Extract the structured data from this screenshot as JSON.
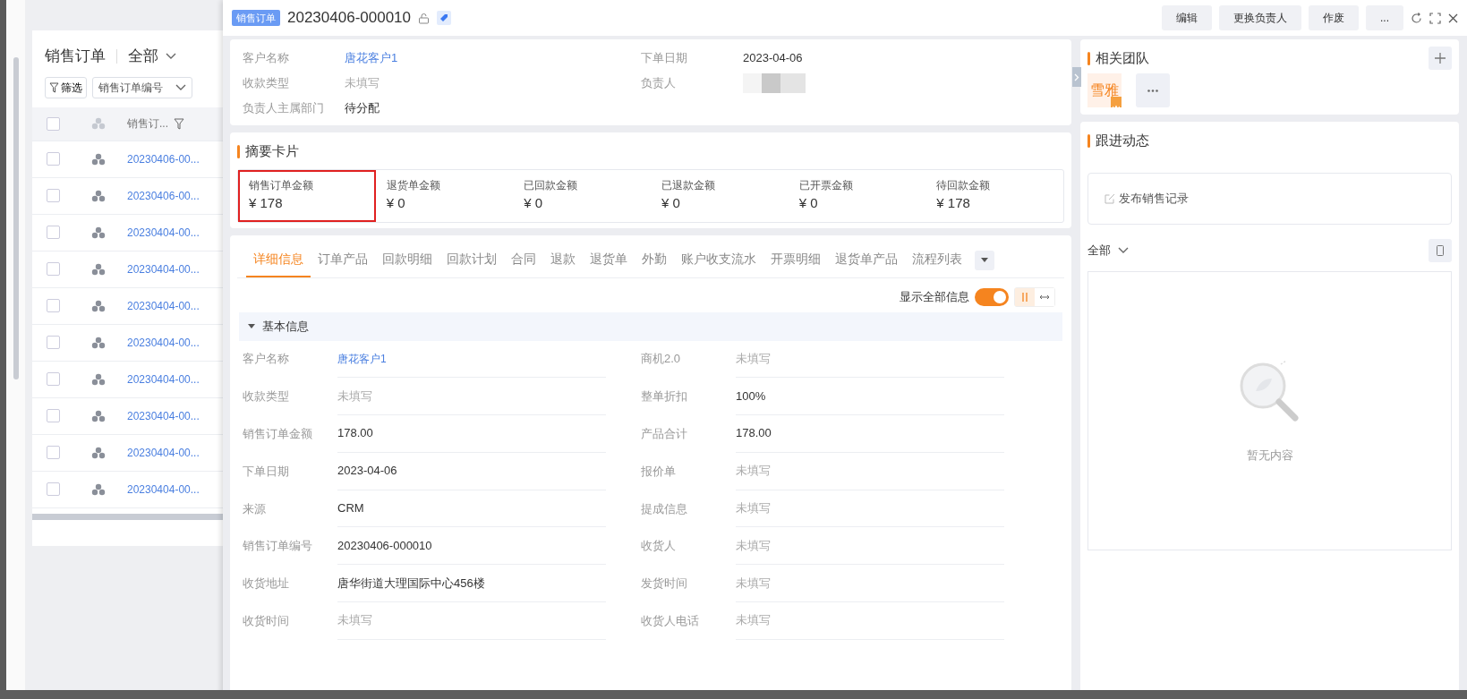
{
  "list_panel": {
    "select_all": {
      "checked": false
    },
    "title": "销售订单",
    "view": "全部",
    "filter_button": "筛选",
    "search_field": "销售订单编号",
    "column": "销售订...",
    "rows": [
      {
        "order_no": "20230406-00...",
        "checked": false
      },
      {
        "order_no": "20230406-00...",
        "checked": false
      },
      {
        "order_no": "20230404-00...",
        "checked": false
      },
      {
        "order_no": "20230404-00...",
        "checked": false
      },
      {
        "order_no": "20230404-00...",
        "checked": false
      },
      {
        "order_no": "20230404-00...",
        "checked": false
      },
      {
        "order_no": "20230404-00...",
        "checked": false
      },
      {
        "order_no": "20230404-00...",
        "checked": false
      },
      {
        "order_no": "20230404-00...",
        "checked": false
      },
      {
        "order_no": "20230404-00...",
        "checked": false
      }
    ]
  },
  "header": {
    "tag": "销售订单",
    "title": "20230406-000010",
    "buttons": [
      "编辑",
      "更换负责人",
      "作废",
      "..."
    ]
  },
  "overview": {
    "fields": [
      {
        "label": "客户名称",
        "value": "唐花客户1",
        "kind": "link"
      },
      {
        "label": "下单日期",
        "value": "2023-04-06",
        "kind": "text"
      },
      {
        "label": "收款类型",
        "value": "未填写",
        "kind": "empty"
      },
      {
        "label": "负责人",
        "kind": "blurred"
      },
      {
        "label": "负责人主属部门",
        "value": "待分配",
        "kind": "text"
      }
    ]
  },
  "summary": {
    "title": "摘要卡片",
    "metrics": [
      {
        "label": "销售订单金额",
        "value": "¥ 178",
        "highlighted": true
      },
      {
        "label": "退货单金额",
        "value": "¥ 0",
        "highlighted": false
      },
      {
        "label": "已回款金额",
        "value": "¥ 0",
        "highlighted": false
      },
      {
        "label": "已退款金额",
        "value": "¥ 0",
        "highlighted": false
      },
      {
        "label": "已开票金额",
        "value": "¥ 0",
        "highlighted": false
      },
      {
        "label": "待回款金额",
        "value": "¥ 178",
        "highlighted": false
      }
    ]
  },
  "tabs": [
    {
      "label": "详细信息",
      "selected": true
    },
    {
      "label": "订单产品",
      "selected": false
    },
    {
      "label": "回款明细",
      "selected": false
    },
    {
      "label": "回款计划",
      "selected": false
    },
    {
      "label": "合同",
      "selected": false
    },
    {
      "label": "退款",
      "selected": false
    },
    {
      "label": "退货单",
      "selected": false
    },
    {
      "label": "外勤",
      "selected": false
    },
    {
      "label": "账户收支流水",
      "selected": false
    },
    {
      "label": "开票明细",
      "selected": false
    },
    {
      "label": "退货单产品",
      "selected": false
    },
    {
      "label": "流程列表",
      "selected": false
    }
  ],
  "show_all": {
    "label": "显示全部信息",
    "on": true
  },
  "section": {
    "title": "基本信息",
    "expanded": true,
    "fields": [
      {
        "label": "客户名称",
        "value": "唐花客户1",
        "kind": "link"
      },
      {
        "label": "商机2.0",
        "value": "未填写",
        "kind": "empty"
      },
      {
        "label": "收款类型",
        "value": "未填写",
        "kind": "empty"
      },
      {
        "label": "整单折扣",
        "value": "100%",
        "kind": "text"
      },
      {
        "label": "销售订单金额",
        "value": "178.00",
        "kind": "text"
      },
      {
        "label": "产品合计",
        "value": "178.00",
        "kind": "text"
      },
      {
        "label": "下单日期",
        "value": "2023-04-06",
        "kind": "text"
      },
      {
        "label": "报价单",
        "value": "未填写",
        "kind": "empty"
      },
      {
        "label": "来源",
        "value": "CRM",
        "kind": "text"
      },
      {
        "label": "提成信息",
        "value": "未填写",
        "kind": "empty"
      },
      {
        "label": "销售订单编号",
        "value": "20230406-000010",
        "kind": "text"
      },
      {
        "label": "收货人",
        "value": "未填写",
        "kind": "empty"
      },
      {
        "label": "收货地址",
        "value": "唐华街道大理国际中心456楼",
        "kind": "text"
      },
      {
        "label": "发货时间",
        "value": "未填写",
        "kind": "empty"
      },
      {
        "label": "收货时间",
        "value": "未填写",
        "kind": "empty"
      },
      {
        "label": "收货人电话",
        "value": "未填写",
        "kind": "empty"
      }
    ]
  },
  "team": {
    "title": "相关团队",
    "members": [
      {
        "name": "雪雅",
        "owner": true
      }
    ]
  },
  "activity": {
    "title": "跟进动态",
    "post_button": "发布销售记录",
    "filter": "全部",
    "empty_text": "暂无内容"
  }
}
